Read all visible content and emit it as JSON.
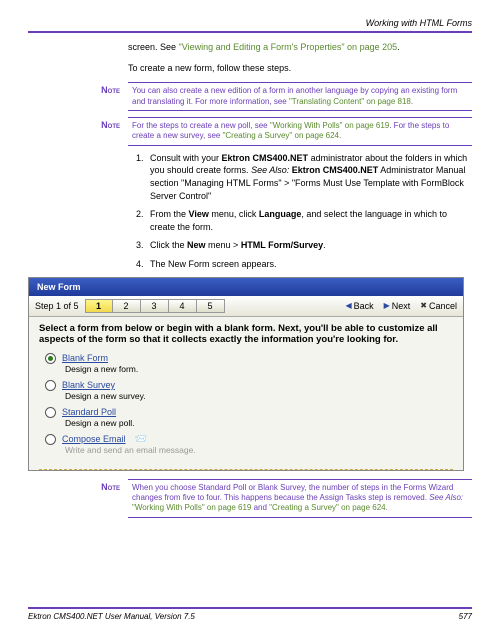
{
  "header": {
    "title": "Working with HTML Forms"
  },
  "intro": {
    "pre_link": "screen. See ",
    "link": "\"Viewing and Editing a Form's Properties\" on page 205",
    "post_link": ".",
    "line2": "To create a new form, follow these steps."
  },
  "notes": {
    "label": "Note",
    "note1": {
      "pre": "You can also create a new edition of a form in another language by copying an existing form and translating it. For more information, see ",
      "link": "\"Translating Content\" on page 818",
      "post": "."
    },
    "note2": {
      "pre": "For the steps to create a new poll, see ",
      "link1": "\"Working With Polls\" on page 619",
      "mid": ". For the steps to create a new survey, see ",
      "link2": "\"Creating a Survey\" on page 624",
      "post": "."
    },
    "note3": {
      "pre": "When you choose Standard Poll or Blank Survey, the number of steps in the Forms Wizard changes from five to four. This happens because the Assign Tasks step is removed. ",
      "see": "See Also: ",
      "link1": "\"Working With Polls\" on page 619",
      "mid": " and ",
      "link2": "\"Creating a Survey\" on page 624",
      "post": "."
    }
  },
  "steps": {
    "s1": {
      "pre": "Consult with your ",
      "b1": "Ektron CMS400.NET",
      "mid1": " administrator about the folders in which you should create forms. ",
      "see": "See Also: ",
      "b2": "Ektron CMS400.NET",
      "mid2": " Administrator Manual section \"Managing HTML Forms\" > \"Forms Must Use Template with FormBlock Server Control\""
    },
    "s2": {
      "pre": "From the ",
      "b1": "View",
      "mid": " menu, click ",
      "b2": "Language",
      "post": ", and select the language in which to create the form."
    },
    "s3": {
      "pre": "Click the ",
      "b1": "New",
      "mid": " menu > ",
      "b2": "HTML Form/Survey",
      "post": "."
    },
    "s4": "The New Form screen appears."
  },
  "dialog": {
    "title": "New Form",
    "step_label": "Step 1 of 5",
    "tabs": [
      "1",
      "2",
      "3",
      "4",
      "5"
    ],
    "back": "Back",
    "next": "Next",
    "cancel": "Cancel",
    "lead": "Select a form from below or begin with a blank form. Next, you'll be able to customize all aspects of the form so that it collects exactly the information you're looking for.",
    "options": [
      {
        "label": "Blank Form",
        "desc": "Design a new form.",
        "selected": true
      },
      {
        "label": "Blank Survey",
        "desc": "Design a new survey.",
        "selected": false
      },
      {
        "label": "Standard Poll",
        "desc": "Design a new poll.",
        "selected": false
      },
      {
        "label": "Compose Email",
        "desc": "Write and send an email message.",
        "selected": false,
        "icon": "mail"
      }
    ]
  },
  "footer": {
    "manual": "Ektron CMS400.NET User Manual, Version 7.5",
    "page": "577"
  }
}
